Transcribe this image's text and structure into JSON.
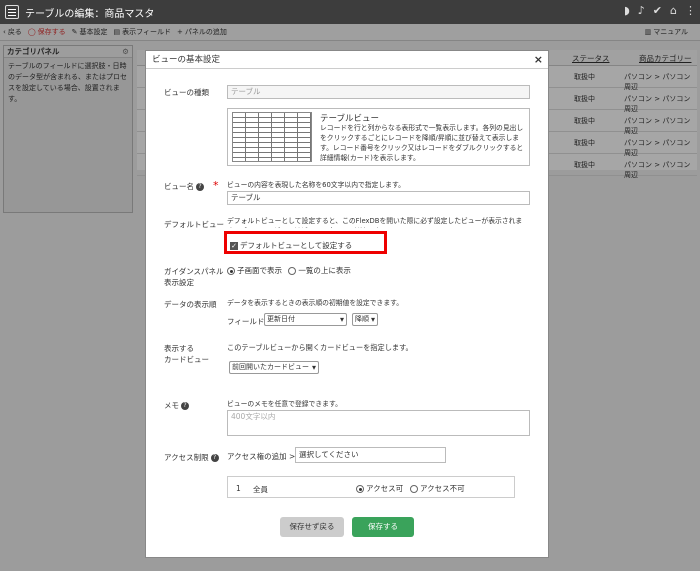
{
  "topbar": {
    "title": "テーブルの編集：商品マスタ"
  },
  "toolbar": {
    "back": "戻る",
    "save": "保存する",
    "basic_settings": "基本設定",
    "display_fields": "表示フィールド",
    "add_panel": "パネルの追加",
    "manual": "マニュアル"
  },
  "category_panel": {
    "title": "カテゴリパネル",
    "description": "テーブルのフィールドに選択肢・日時のデータ型が含まれる、またはプロセスを設定している場合、設置されます。"
  },
  "background_table": {
    "headers": [
      "ステータス",
      "商品カテゴリー"
    ],
    "rows": [
      [
        "取扱中",
        "パソコン > パソコン周辺"
      ],
      [
        "取扱中",
        "パソコン > パソコン周辺"
      ],
      [
        "取扱中",
        "パソコン > パソコン周辺"
      ],
      [
        "取扱中",
        "パソコン > パソコン周辺"
      ],
      [
        "取扱中",
        "パソコン > パソコン周辺"
      ]
    ]
  },
  "modal": {
    "title": "ビューの基本設定",
    "view_type": {
      "label": "ビューの種類",
      "value": "テーブル",
      "preview_title": "テーブルビュー",
      "preview_desc": "レコードを行と列からなる表形式で一覧表示します。各列の見出しをクリックするごとにレコードを降順/昇順に並び替えて表示します。レコード番号をクリック又はレコードをダブルクリックすると詳細情報(カード)を表示します。"
    },
    "view_name": {
      "label": "ビュー名",
      "hint": "ビューの内容を表現した名称を60文字以内で指定します。",
      "value": "テーブル"
    },
    "default_view": {
      "label": "デフォルトビュー",
      "desc": "デフォルトビューとして設定すると、このFlexDBを開いた際に必ず設定したビューが表示されます。デフォルトビューはビューの中で1つだけです。",
      "checkbox_label": "デフォルトビューとして設定する"
    },
    "guidance": {
      "label_line1": "ガイダンスパネル",
      "label_line2": "表示設定",
      "option1": "子画面で表示",
      "option2": "一覧の上に表示"
    },
    "display_order": {
      "label": "データの表示順",
      "hint": "データを表示するときの表示順の初期値を設定できます。",
      "field_label": "フィールド",
      "field_value": "更新日付",
      "order_value": "降順"
    },
    "card_view": {
      "label_line1": "表示する",
      "label_line2": "カードビュー",
      "hint": "このテーブルビューから開くカードビューを指定します。",
      "value": "前回開いたカードビュー"
    },
    "memo": {
      "label": "メモ",
      "hint": "ビューのメモを任意で登録できます。",
      "placeholder": "400文字以内"
    },
    "access": {
      "label": "アクセス制限",
      "add_label": "アクセス権の追加 >",
      "select_placeholder": "選択してください",
      "row_number": "1",
      "row_name": "全員",
      "allow": "アクセス可",
      "deny": "アクセス不可"
    },
    "buttons": {
      "back": "保存せず戻る",
      "save": "保存する"
    }
  }
}
